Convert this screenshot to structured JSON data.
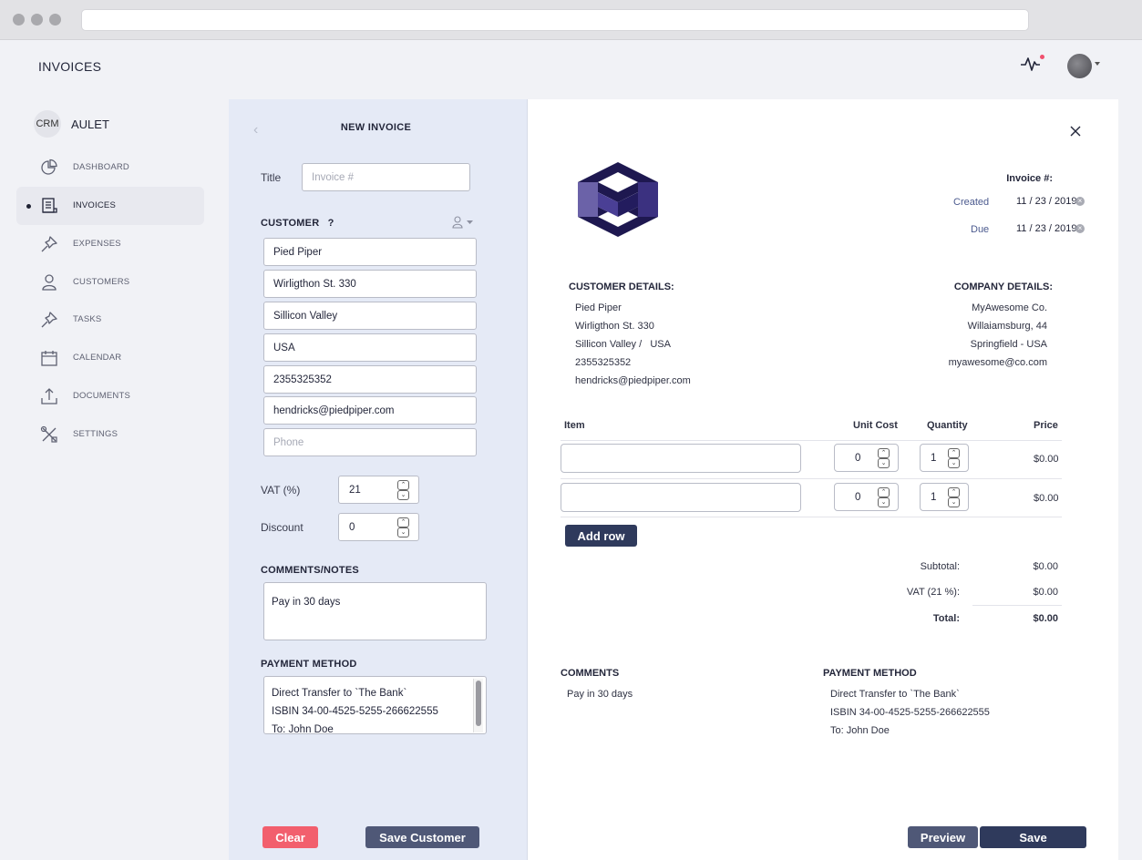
{
  "app": {
    "title": "INVOICES",
    "brand_badge": "CRM",
    "brand_name": "AULET"
  },
  "sidebar": {
    "items": [
      {
        "label": "DASHBOARD",
        "icon": "pie-chart-icon",
        "active": false
      },
      {
        "label": "INVOICES",
        "icon": "invoice-icon",
        "active": true
      },
      {
        "label": "EXPENSES",
        "icon": "pin-icon",
        "active": false
      },
      {
        "label": "CUSTOMERS",
        "icon": "user-icon",
        "active": false
      },
      {
        "label": "TASKS",
        "icon": "pin-icon",
        "active": false
      },
      {
        "label": "CALENDAR",
        "icon": "calendar-icon",
        "active": false
      },
      {
        "label": "DOCUMENTS",
        "icon": "upload-icon",
        "active": false
      },
      {
        "label": "SETTINGS",
        "icon": "tools-icon",
        "active": false
      }
    ]
  },
  "form": {
    "title": "NEW INVOICE",
    "title_label": "Title",
    "title_placeholder": "Invoice #",
    "customer_heading": "CUSTOMER",
    "customer_help": "?",
    "customer_fields": [
      {
        "value": "Pied Piper",
        "placeholder": ""
      },
      {
        "value": "Wirligthon St. 330",
        "placeholder": ""
      },
      {
        "value": "Sillicon Valley",
        "placeholder": ""
      },
      {
        "value": "USA",
        "placeholder": ""
      },
      {
        "value": "2355325352",
        "placeholder": ""
      },
      {
        "value": "hendricks@piedpiper.com",
        "placeholder": ""
      },
      {
        "value": "",
        "placeholder": "Phone"
      }
    ],
    "vat_label": "VAT (%)",
    "vat_value": "21",
    "discount_label": "Discount",
    "discount_value": "0",
    "comments_heading": "COMMENTS/NOTES",
    "comments_value": "Pay in 30 days",
    "payment_heading": "PAYMENT METHOD",
    "payment_lines": [
      "Direct Transfer to `The Bank`",
      "ISBIN 34-00-4525-5255-266622555",
      "To: John Doe"
    ],
    "clear_label": "Clear",
    "save_customer_label": "Save Customer"
  },
  "invoice": {
    "invoice_no_label": "Invoice #:",
    "created_label": "Created",
    "created_value": "11 / 23 / 2019",
    "due_label": "Due",
    "due_value": "11 / 23 / 2019",
    "customer_heading": "CUSTOMER DETAILS:",
    "customer_lines": [
      "Pied Piper",
      "Wirligthon St. 330",
      "Sillicon Valley /   USA",
      "2355325352",
      "hendricks@piedpiper.com"
    ],
    "company_heading": "COMPANY DETAILS:",
    "company_lines": [
      "MyAwesome Co.",
      "Willaiamsburg, 44",
      "Springfield - USA",
      "myawesome@co.com"
    ],
    "columns": {
      "item": "Item",
      "unit_cost": "Unit Cost",
      "quantity": "Quantity",
      "price": "Price"
    },
    "rows": [
      {
        "item": "",
        "unit_cost": "0",
        "quantity": "1",
        "price": "$0.00"
      },
      {
        "item": "",
        "unit_cost": "0",
        "quantity": "1",
        "price": "$0.00"
      }
    ],
    "add_row_label": "Add row",
    "subtotal_label": "Subtotal:",
    "subtotal_value": "$0.00",
    "vat_label": "VAT (21 %):",
    "vat_value": "$0.00",
    "total_label": "Total:",
    "total_value": "$0.00",
    "comments_heading": "COMMENTS",
    "comments_value": "Pay in 30 days",
    "payment_heading": "PAYMENT METHOD",
    "payment_lines": [
      "Direct Transfer to `The Bank`",
      "ISBIN 34-00-4525-5255-266622555",
      "To: John Doe"
    ],
    "preview_label": "Preview",
    "save_label": "Save"
  },
  "colors": {
    "primary": "#3a4466",
    "danger": "#f25f6d",
    "panel": "#e5eaf6",
    "logo": "#1e1850"
  }
}
